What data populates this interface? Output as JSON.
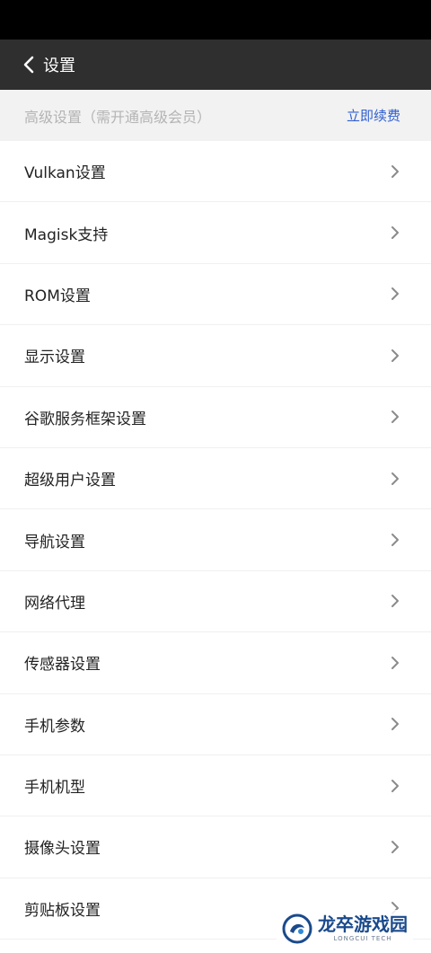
{
  "header": {
    "title": "设置",
    "back_icon": "chevron-left-icon"
  },
  "section": {
    "title": "高级设置（需开通高级会员）",
    "renew_label": "立即续费",
    "accent": "#2f5fd0"
  },
  "items": [
    {
      "label": "Vulkan设置"
    },
    {
      "label": "Magisk支持"
    },
    {
      "label": "ROM设置"
    },
    {
      "label": "显示设置"
    },
    {
      "label": "谷歌服务框架设置"
    },
    {
      "label": "超级用户设置"
    },
    {
      "label": "导航设置"
    },
    {
      "label": "网络代理"
    },
    {
      "label": "传感器设置"
    },
    {
      "label": "手机参数"
    },
    {
      "label": "手机机型"
    },
    {
      "label": "摄像头设置"
    },
    {
      "label": "剪贴板设置"
    }
  ],
  "watermark": {
    "name": "龙卒游戏园",
    "en": "LONGCUI TECH"
  },
  "colors": {
    "status_bar": "#000000",
    "app_bar": "#2f2f2f",
    "section_bg": "#f2f2f2"
  }
}
